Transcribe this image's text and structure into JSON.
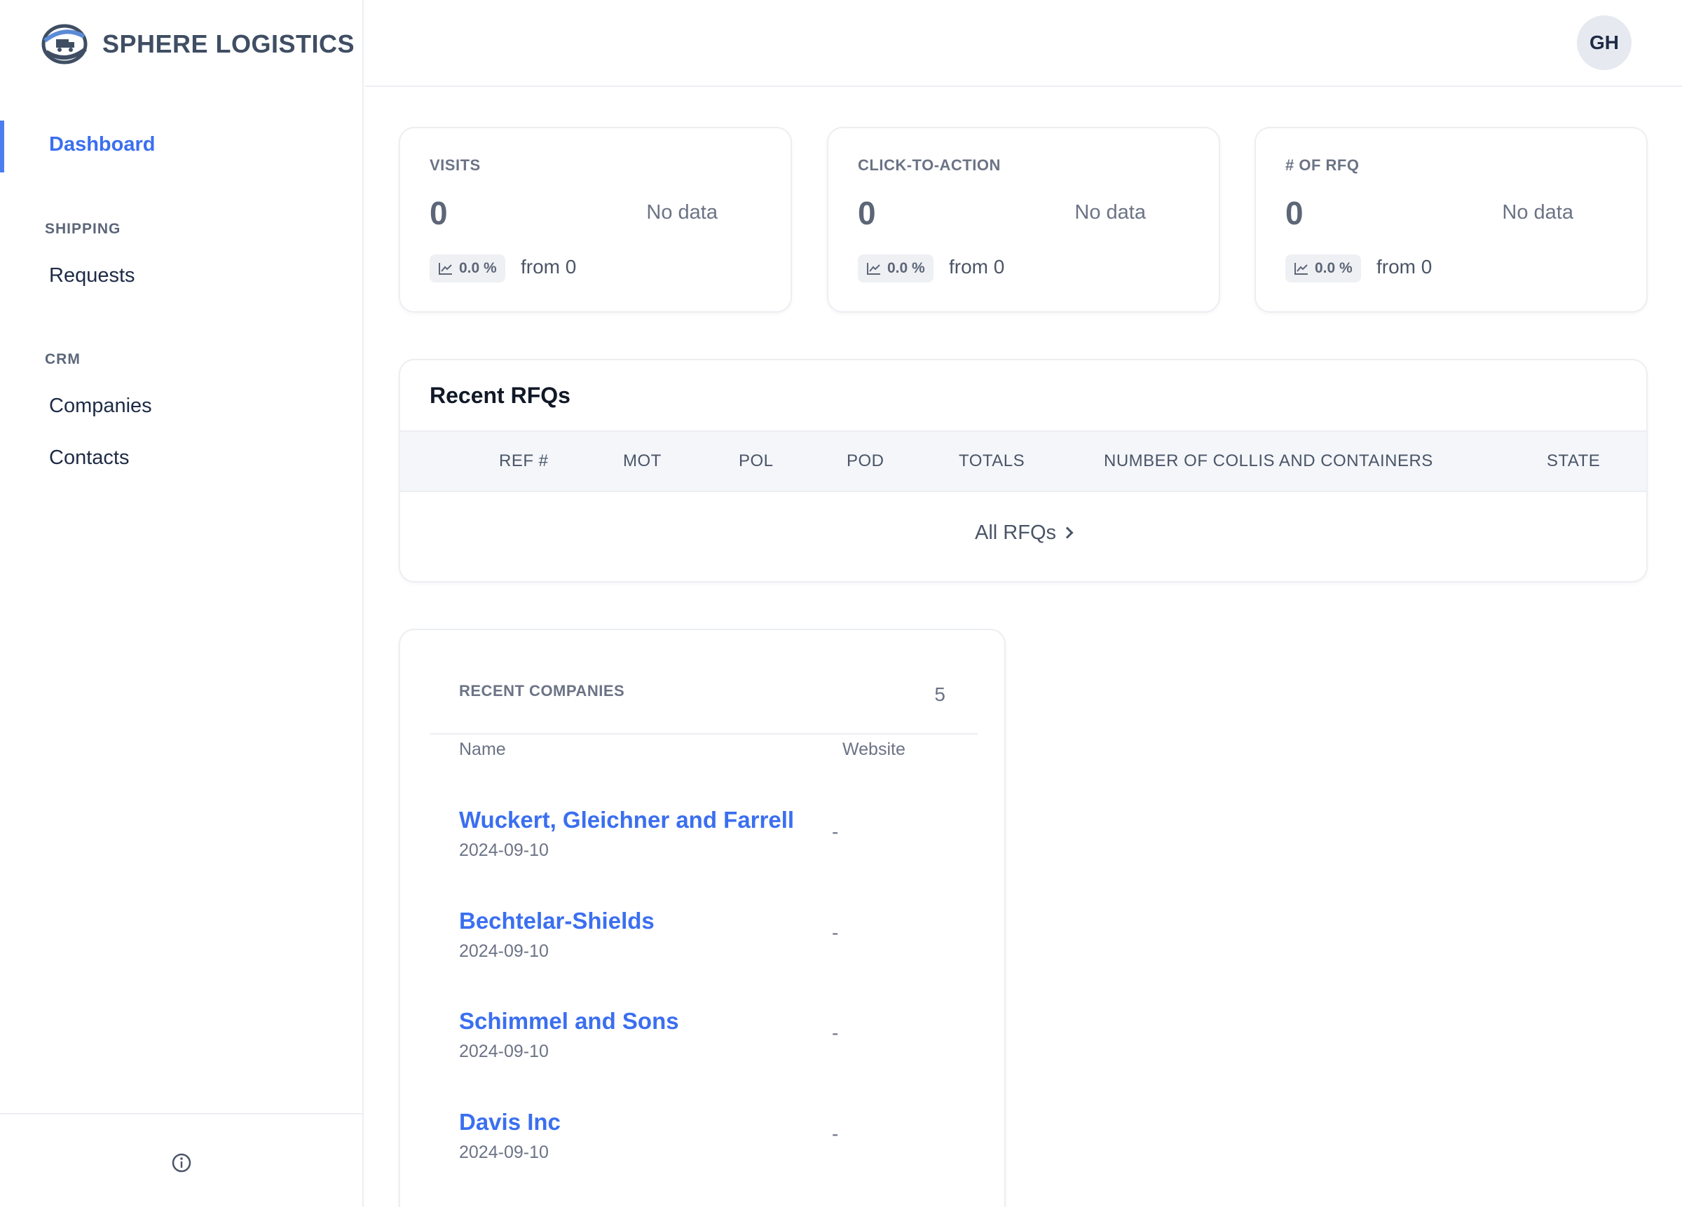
{
  "app": {
    "brand": "SPHERE LOGISTICS",
    "accent_color": "#3b6ff0",
    "user_initials": "GH"
  },
  "sidebar": {
    "active": "Dashboard",
    "dashboard": "Dashboard",
    "sections": [
      {
        "title": "SHIPPING",
        "items": [
          "Requests"
        ]
      },
      {
        "title": "CRM",
        "items": [
          "Companies",
          "Contacts"
        ]
      }
    ],
    "footer_icon": "info-icon"
  },
  "stats": [
    {
      "label": "VISITS",
      "value": "0",
      "nodata": "No data",
      "change": "0.0 %",
      "from": "from 0"
    },
    {
      "label": "CLICK-TO-ACTION",
      "value": "0",
      "nodata": "No data",
      "change": "0.0 %",
      "from": "from 0"
    },
    {
      "label": "# OF RFQ",
      "value": "0",
      "nodata": "No data",
      "change": "0.0 %",
      "from": "from 0"
    }
  ],
  "rfqs": {
    "title": "Recent RFQs",
    "columns": [
      "REF #",
      "MOT",
      "POL",
      "POD",
      "TOTALS",
      "NUMBER OF COLLIS AND CONTAINERS",
      "STATE"
    ],
    "link": "All RFQs"
  },
  "companies": {
    "label": "RECENT COMPANIES",
    "count": "5",
    "columns": [
      "Name",
      "Website"
    ],
    "rows": [
      {
        "name": "Wuckert, Gleichner and Farrell",
        "date": "2024-09-10",
        "website": "-"
      },
      {
        "name": "Bechtelar-Shields",
        "date": "2024-09-10",
        "website": "-"
      },
      {
        "name": "Schimmel and Sons",
        "date": "2024-09-10",
        "website": "-"
      },
      {
        "name": "Davis Inc",
        "date": "2024-09-10",
        "website": "-"
      }
    ]
  }
}
